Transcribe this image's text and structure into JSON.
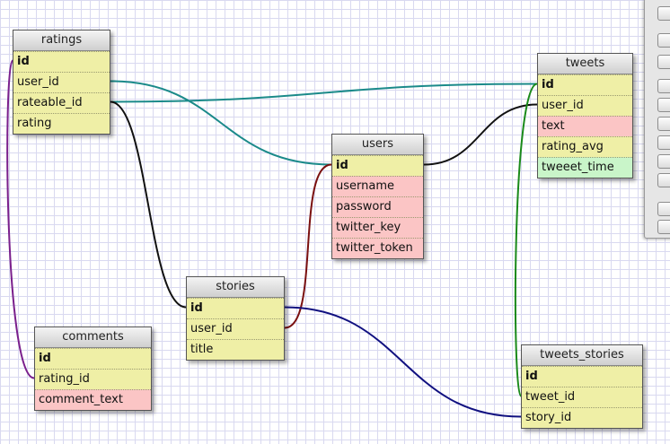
{
  "tables": {
    "ratings": {
      "title": "ratings",
      "fields": [
        {
          "name": "id",
          "key": true,
          "color": "yellow"
        },
        {
          "name": "user_id",
          "key": false,
          "color": "yellow"
        },
        {
          "name": "rateable_id",
          "key": false,
          "color": "yellow"
        },
        {
          "name": "rating",
          "key": false,
          "color": "yellow"
        }
      ]
    },
    "tweets": {
      "title": "tweets",
      "fields": [
        {
          "name": "id",
          "key": true,
          "color": "yellow"
        },
        {
          "name": "user_id",
          "key": false,
          "color": "yellow"
        },
        {
          "name": "text",
          "key": false,
          "color": "pink"
        },
        {
          "name": "rating_avg",
          "key": false,
          "color": "yellow"
        },
        {
          "name": "tweeet_time",
          "key": false,
          "color": "green"
        }
      ]
    },
    "users": {
      "title": "users",
      "fields": [
        {
          "name": "id",
          "key": true,
          "color": "yellow"
        },
        {
          "name": "username",
          "key": false,
          "color": "pink"
        },
        {
          "name": "password",
          "key": false,
          "color": "pink"
        },
        {
          "name": "twitter_key",
          "key": false,
          "color": "pink"
        },
        {
          "name": "twitter_token",
          "key": false,
          "color": "pink"
        }
      ]
    },
    "stories": {
      "title": "stories",
      "fields": [
        {
          "name": "id",
          "key": true,
          "color": "yellow"
        },
        {
          "name": "user_id",
          "key": false,
          "color": "yellow"
        },
        {
          "name": "title",
          "key": false,
          "color": "yellow"
        }
      ]
    },
    "comments": {
      "title": "comments",
      "fields": [
        {
          "name": "id",
          "key": true,
          "color": "yellow"
        },
        {
          "name": "rating_id",
          "key": false,
          "color": "yellow"
        },
        {
          "name": "comment_text",
          "key": false,
          "color": "pink"
        }
      ]
    },
    "tweets_stories": {
      "title": "tweets_stories",
      "fields": [
        {
          "name": "id",
          "key": true,
          "color": "yellow"
        },
        {
          "name": "tweet_id",
          "key": false,
          "color": "yellow"
        },
        {
          "name": "story_id",
          "key": false,
          "color": "yellow"
        }
      ]
    }
  },
  "relations": [
    {
      "from": "ratings.user_id",
      "to": "users.id",
      "color": "#1b8a8a"
    },
    {
      "from": "ratings.rateable_id",
      "to": "tweets.id",
      "color": "#1b8a8a"
    },
    {
      "from": "ratings.rateable_id",
      "to": "stories.id",
      "color": "#111111"
    },
    {
      "from": "ratings.id",
      "to": "comments.rating_id",
      "color": "#7a1f8c"
    },
    {
      "from": "users.id",
      "to": "tweets.user_id",
      "color": "#111111"
    },
    {
      "from": "users.id",
      "to": "stories.user_id",
      "color": "#7a1010"
    },
    {
      "from": "tweets.id",
      "to": "tweets_stories.tweet_id",
      "color": "#1a8a1a"
    },
    {
      "from": "stories.id",
      "to": "tweets_stories.story_id",
      "color": "#101080"
    }
  ]
}
